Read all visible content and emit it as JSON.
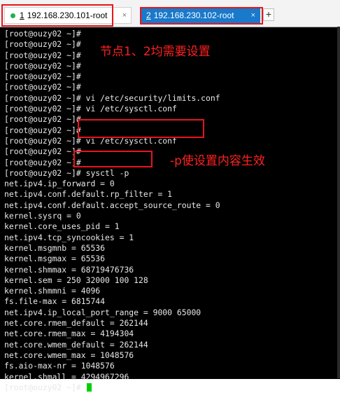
{
  "tabs": [
    {
      "index": "1",
      "title": "192.168.230.101-root",
      "close": "×",
      "active": false,
      "status_color": "#22b14c"
    },
    {
      "index": "2",
      "title": "192.168.230.102-root",
      "close": "×",
      "active": true
    }
  ],
  "tab_add_label": "+",
  "annotations": {
    "note1": "节点1、2均需要设置",
    "note2": "-p使设置内容生效",
    "color": "#e8151b"
  },
  "terminal": {
    "lines": [
      "[root@ouzy02 ~]#",
      "[root@ouzy02 ~]#",
      "[root@ouzy02 ~]#",
      "[root@ouzy02 ~]#",
      "[root@ouzy02 ~]#",
      "[root@ouzy02 ~]#",
      "[root@ouzy02 ~]# vi /etc/security/limits.conf",
      "[root@ouzy02 ~]# vi /etc/sysctl.conf",
      "[root@ouzy02 ~]#",
      "[root@ouzy02 ~]#",
      "[root@ouzy02 ~]# vi /etc/sysctl.conf",
      "[root@ouzy02 ~]#",
      "[root@ouzy02 ~]#",
      "[root@ouzy02 ~]# sysctl -p",
      "net.ipv4.ip_forward = 0",
      "net.ipv4.conf.default.rp_filter = 1",
      "net.ipv4.conf.default.accept_source_route = 0",
      "kernel.sysrq = 0",
      "kernel.core_uses_pid = 1",
      "net.ipv4.tcp_syncookies = 1",
      "kernel.msgmnb = 65536",
      "kernel.msgmax = 65536",
      "kernel.shmmax = 68719476736",
      "kernel.sem = 250 32000 100 128",
      "kernel.shmmni = 4096",
      "fs.file-max = 6815744",
      "net.ipv4.ip_local_port_range = 9000 65000",
      "net.core.rmem_default = 262144",
      "net.core.rmem_max = 4194304",
      "net.core.wmem_default = 262144",
      "net.core.wmem_max = 1048576",
      "fs.aio-max-nr = 1048576",
      "kernel.shmall = 4294967296"
    ],
    "prompt": "[root@ouzy02 ~]# ",
    "background": "#000000",
    "foreground": "#e8e8e8",
    "cursor_color": "#00d000"
  }
}
